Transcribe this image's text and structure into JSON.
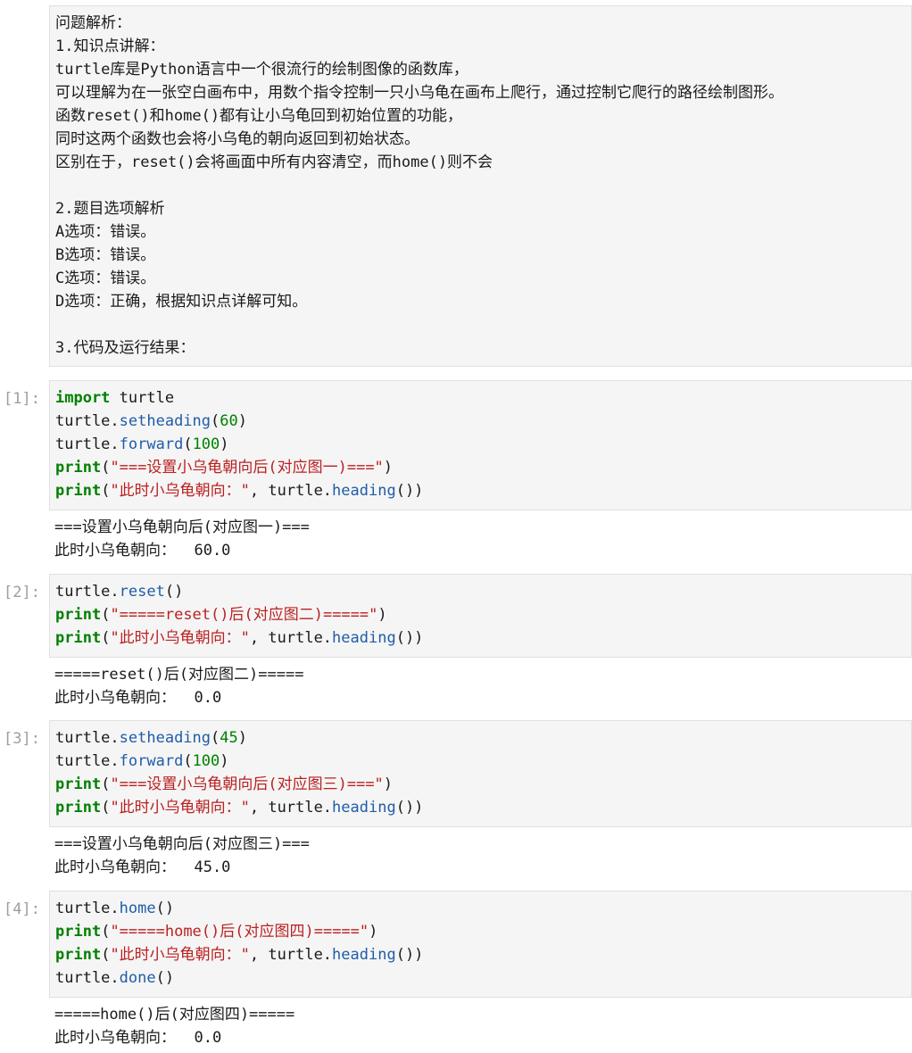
{
  "markdown": {
    "lines": [
      "问题解析：",
      "1.知识点讲解：",
      "turtle库是Python语言中一个很流行的绘制图像的函数库，",
      "可以理解为在一张空白画布中，用数个指令控制一只小乌龟在画布上爬行，通过控制它爬行的路径绘制图形。",
      "函数reset()和home()都有让小乌龟回到初始位置的功能，",
      "同时这两个函数也会将小乌龟的朝向返回到初始状态。",
      "区别在于，reset()会将画面中所有内容清空，而home()则不会",
      "",
      "2.题目选项解析",
      "A选项：错误。",
      "B选项：错误。",
      "C选项：错误。",
      "D选项：正确，根据知识点详解可知。",
      "",
      "3.代码及运行结果："
    ]
  },
  "cells": [
    {
      "prompt": "[1]:",
      "code": [
        [
          [
            "kw",
            "import"
          ],
          [
            "pl",
            " turtle"
          ]
        ],
        [
          [
            "pl",
            "turtle."
          ],
          [
            "fn",
            "setheading"
          ],
          [
            "pl",
            "("
          ],
          [
            "num",
            "60"
          ],
          [
            "pl",
            ")"
          ]
        ],
        [
          [
            "pl",
            "turtle."
          ],
          [
            "fn",
            "forward"
          ],
          [
            "pl",
            "("
          ],
          [
            "num",
            "100"
          ],
          [
            "pl",
            ")"
          ]
        ],
        [
          [
            "kw",
            "print"
          ],
          [
            "pl",
            "("
          ],
          [
            "str",
            "\"===设置小乌龟朝向后(对应图一)===\""
          ],
          [
            "pl",
            ")"
          ]
        ],
        [
          [
            "kw",
            "print"
          ],
          [
            "pl",
            "("
          ],
          [
            "str",
            "\"此时小乌龟朝向：\""
          ],
          [
            "pl",
            ", turtle."
          ],
          [
            "fn",
            "heading"
          ],
          [
            "pl",
            "())"
          ]
        ]
      ],
      "output": [
        "===设置小乌龟朝向后(对应图一)===",
        "此时小乌龟朝向：  60.0"
      ]
    },
    {
      "prompt": "[2]:",
      "code": [
        [
          [
            "pl",
            "turtle."
          ],
          [
            "fn",
            "reset"
          ],
          [
            "pl",
            "()"
          ]
        ],
        [
          [
            "kw",
            "print"
          ],
          [
            "pl",
            "("
          ],
          [
            "str",
            "\"=====reset()后(对应图二)=====\""
          ],
          [
            "pl",
            ")"
          ]
        ],
        [
          [
            "kw",
            "print"
          ],
          [
            "pl",
            "("
          ],
          [
            "str",
            "\"此时小乌龟朝向：\""
          ],
          [
            "pl",
            ", turtle."
          ],
          [
            "fn",
            "heading"
          ],
          [
            "pl",
            "())"
          ]
        ]
      ],
      "output": [
        "=====reset()后(对应图二)=====",
        "此时小乌龟朝向：  0.0"
      ]
    },
    {
      "prompt": "[3]:",
      "code": [
        [
          [
            "pl",
            "turtle."
          ],
          [
            "fn",
            "setheading"
          ],
          [
            "pl",
            "("
          ],
          [
            "num",
            "45"
          ],
          [
            "pl",
            ")"
          ]
        ],
        [
          [
            "pl",
            "turtle."
          ],
          [
            "fn",
            "forward"
          ],
          [
            "pl",
            "("
          ],
          [
            "num",
            "100"
          ],
          [
            "pl",
            ")"
          ]
        ],
        [
          [
            "kw",
            "print"
          ],
          [
            "pl",
            "("
          ],
          [
            "str",
            "\"===设置小乌龟朝向后(对应图三)===\""
          ],
          [
            "pl",
            ")"
          ]
        ],
        [
          [
            "kw",
            "print"
          ],
          [
            "pl",
            "("
          ],
          [
            "str",
            "\"此时小乌龟朝向：\""
          ],
          [
            "pl",
            ", turtle."
          ],
          [
            "fn",
            "heading"
          ],
          [
            "pl",
            "())"
          ]
        ]
      ],
      "output": [
        "===设置小乌龟朝向后(对应图三)===",
        "此时小乌龟朝向：  45.0"
      ]
    },
    {
      "prompt": "[4]:",
      "code": [
        [
          [
            "pl",
            "turtle."
          ],
          [
            "fn",
            "home"
          ],
          [
            "pl",
            "()"
          ]
        ],
        [
          [
            "kw",
            "print"
          ],
          [
            "pl",
            "("
          ],
          [
            "str",
            "\"=====home()后(对应图四)=====\""
          ],
          [
            "pl",
            ")"
          ]
        ],
        [
          [
            "kw",
            "print"
          ],
          [
            "pl",
            "("
          ],
          [
            "str",
            "\"此时小乌龟朝向：\""
          ],
          [
            "pl",
            ", turtle."
          ],
          [
            "fn",
            "heading"
          ],
          [
            "pl",
            "())"
          ]
        ],
        [
          [
            "pl",
            "turtle."
          ],
          [
            "fn",
            "done"
          ],
          [
            "pl",
            "()"
          ]
        ]
      ],
      "output": [
        "=====home()后(对应图四)=====",
        "此时小乌龟朝向：  0.0"
      ]
    }
  ]
}
